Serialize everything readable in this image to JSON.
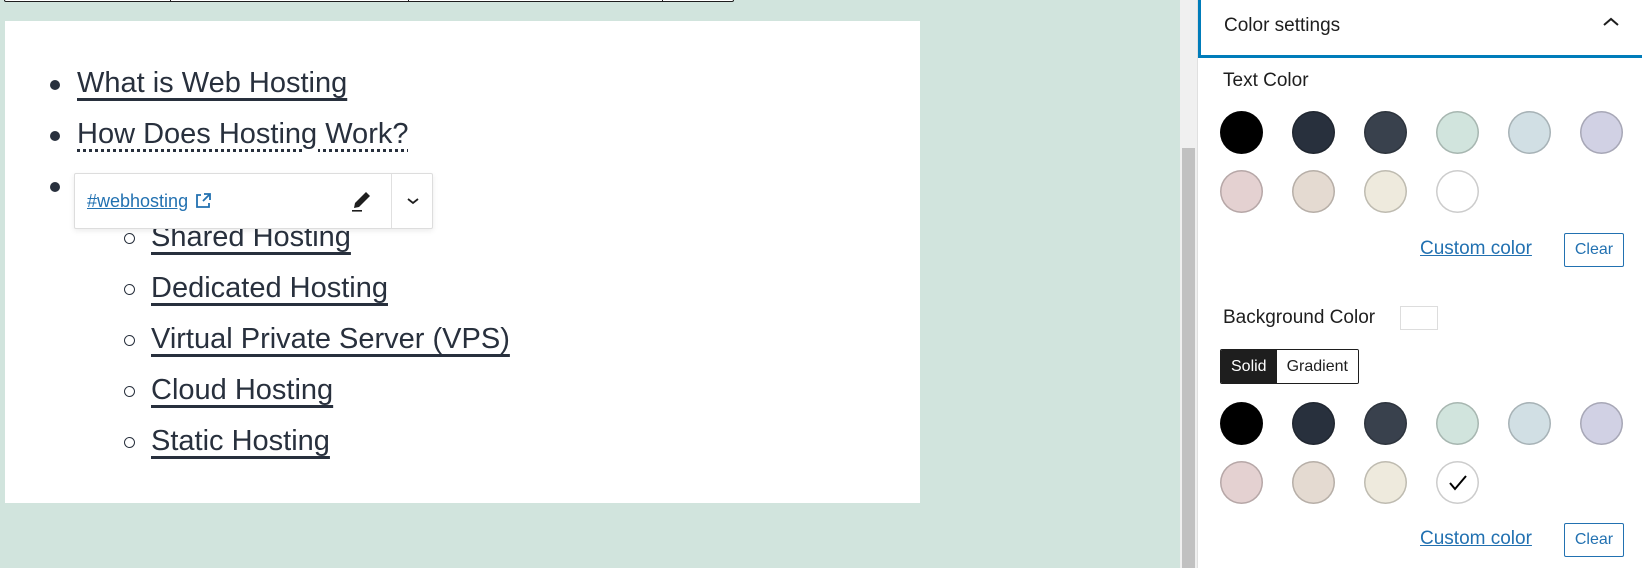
{
  "editor": {
    "list_items": [
      {
        "label": "What is Web Hosting",
        "style": "solid"
      },
      {
        "label": "How Does Hosting Work?",
        "style": "dotted"
      },
      {
        "label": "",
        "style": "solid"
      }
    ],
    "sub_items": [
      {
        "label": "Shared Hosting"
      },
      {
        "label": "Dedicated Hosting"
      },
      {
        "label": "Virtual Private Server (VPS)"
      },
      {
        "label": "Cloud Hosting"
      },
      {
        "label": "Static Hosting"
      }
    ],
    "link_popover": {
      "url": "#webhosting",
      "edit_icon": "pencil-icon",
      "more_icon": "chevron-down-icon",
      "external_icon": "external-link-icon"
    }
  },
  "sidebar": {
    "panel_title": "Color settings",
    "panel_toggle_icon": "chevron-up-icon",
    "text_color": {
      "label": "Text Color",
      "swatches": [
        "#000000",
        "#28303d",
        "#39414d",
        "#d1e4dd",
        "#d1dfe4",
        "#d1d1e4",
        "#e4d1d1",
        "#e4dad1",
        "#eeeadd",
        "#ffffff"
      ],
      "selected": null,
      "custom_label": "Custom color",
      "clear_label": "Clear"
    },
    "background_color": {
      "label": "Background Color",
      "current": "#ffffff",
      "tabs": [
        "Solid",
        "Gradient"
      ],
      "active_tab": "Solid",
      "swatches": [
        "#000000",
        "#28303d",
        "#39414d",
        "#d1e4dd",
        "#d1dfe4",
        "#d1d1e4",
        "#e4d1d1",
        "#e4dad1",
        "#eeeadd",
        "#ffffff"
      ],
      "selected": "#ffffff",
      "custom_label": "Custom color",
      "clear_label": "Clear"
    }
  },
  "colors": {
    "accent": "#007cba",
    "link": "#2271b1",
    "canvas_bg": "#d1e4dd",
    "text": "#28303d"
  }
}
